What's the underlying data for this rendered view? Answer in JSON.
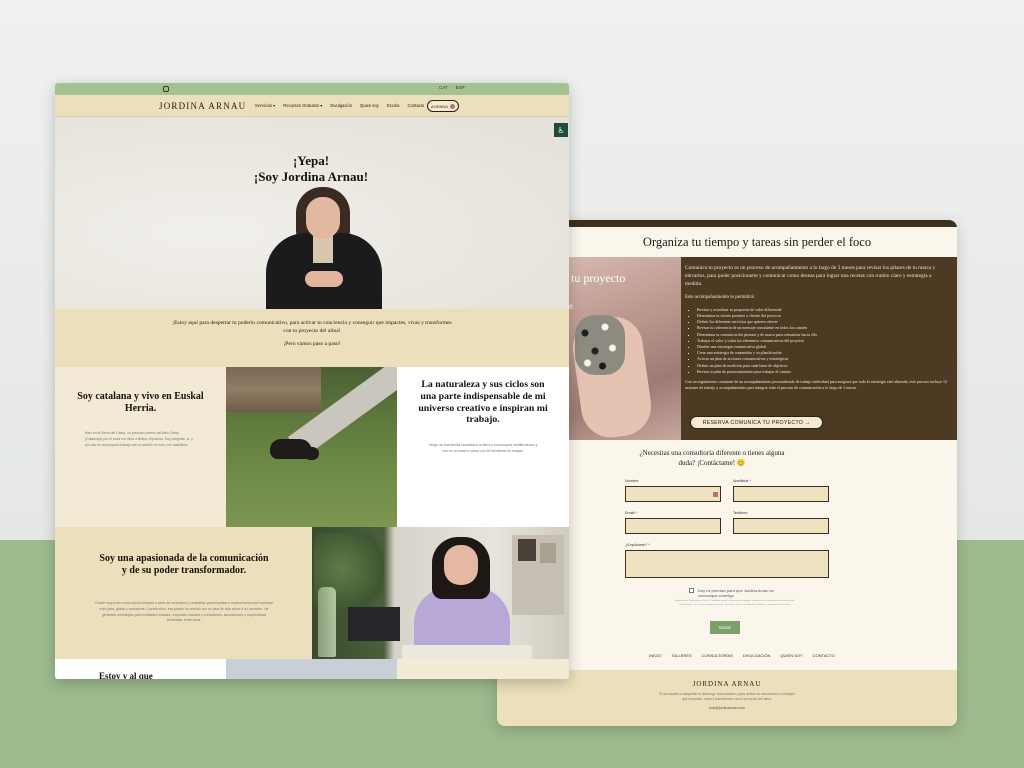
{
  "left_page": {
    "topbar": {
      "langs": [
        "CAT",
        "ESP"
      ]
    },
    "nav": {
      "logo": "JORDINA ARNAU",
      "menu": [
        "Servicios ▾",
        "Recursos Gratuitos ▾",
        "Divulgación",
        "Quien soy",
        "Escola",
        "Contacto"
      ],
      "agenda": "AGENDA"
    },
    "accessibility_icon": "accessibility-icon",
    "hero": {
      "title_line1": "¡Yepa!",
      "title_line2": "¡Soy Jordina Arnau!"
    },
    "intro": {
      "text": "¡Estoy aquí para despertar tu poderío comunicativo, para activar tu conciencia y conseguir que impactes, vivas y transformes con tu proyecto del alma!",
      "closing": "¡Pero vamos paso a paso!"
    },
    "block1": {
      "title": "Soy catalana y vivo en Euskal Herria.",
      "body": "Nací en la Selva del Camp, un precioso pueblo del Baix Camp (Catalunya) por el amor me llevó a Bidea, Gipuzkoa. Soy polígrafa, sí, y por eso en mi proyecto trabajo con el cambio, el euro y el castellano."
    },
    "block2": {
      "title": "La naturaleza y sus ciclos son una parte indispensable de mi universo creativo e inspiran mi trabajo.",
      "body": "Vengo de una familia vinculada a la tierra y los bosques mediterráneos y vivo en un caserío vasco con 50 hectáreas de bosque."
    },
    "block3": {
      "title": "Soy una apasionada de la comunicación y de su poder transformador.",
      "body": "Desde muy joven como acción integrar a partir de conceptos y campañas para impulsar a mucha fuerza una sociedad más justa, global y consciente. Cuenta años, esa pasión ha crecido con un plus de vida sobre a mí vocación. He generado estrategias para entidades sociales, empresas sociales y conscientes, asociaciones y cooperativas feministas, entre otros."
    },
    "block4": {
      "title": "Estoy y al que"
    }
  },
  "right_page": {
    "heading": "Organiza tu tiempo y tareas sin perder el foco",
    "photo_title": "tu proyecto",
    "photo_sub": "e",
    "intro": "Comunica tu proyecto es un proceso de acompañamiento a lo largo de 3 meses para revisar los pilares de tu marca y elevarlos, para poder posicionarte y comunicar como deseas para lograr una recetas con rumbo claro y estrategia a medida.",
    "sub": "Este acompañamiento te permitirá:",
    "bullets": [
      "Revisar y actualizar tu propuesta de valor diferencial",
      "Determinar tu cliente presente o cliente del proyecto",
      "Definir los diferentes servicios que quieres ofrecer",
      "Revisar tu coherencia de un mensaje consistente en todos los canales",
      "Determinar tu comunicación persona y de marca para comunicar hacia ella",
      "Trabajar el valor y todos los elementos comunicativos del proyecto",
      "Diseñar una estrategia comunicativa global",
      "Crear una estrategia de contenidos y su planificación",
      "Activar un plan de acciones comunicativas y estratégicas",
      "Definir un plan de medición para cada línea de objetivos",
      "Revisar tu plan de posicionamiento para trabajar el camino"
    ],
    "outro": "Con un seguimiento constante de un acompañamiento personalizado de trabajo individual para asegurar que toda la estrategia esté alineada, este proceso incluye 12 sesiones de trabajo y acompañamiento para integrar todo el proceso de comunicación a lo largo de 3 meses.",
    "cta": "RESERVA COMUNICA TU PROYECTO →",
    "form": {
      "title": "¿Necesitas una consultoría diferente o tienes alguna duda? ¡Contáctame! 😊",
      "name_label": "Nombre",
      "surname_label": "Apellidos *",
      "email_label": "Email *",
      "phone_label": "Teléfono",
      "message_label": "¿Explícame? *",
      "consent": "Doy mi permiso para que Jordina Arnau se comunique conmigo",
      "legal": "Responsable: Jordina Arnau Cortés. Finalidad: enviar la información solicitada. Legitimación: consentimiento del interesado. Destinatarios: no se cederán datos a terceros. Derechos: acceso, rectificación, limitación y supresión de los datos.",
      "send": "Enviar"
    },
    "footer_nav": [
      "INICIO",
      "TALLERES",
      "CONSULTORÍAS",
      "DIVULGACIÓN",
      "QUIÉN SOY",
      "CONTACTO"
    ],
    "footer": {
      "logo": "JORDINA ARNAU",
      "text": "Te acompaño a despertar tu liderazgo comunicativo, para activar tu conciencia y conseguir que impactes, vivas y transformes con tu proyecto del alma.",
      "email": "hola@jordinaarnau.com"
    }
  },
  "colors": {
    "green_band": "#a3c28f",
    "beige": "#ebdfbc",
    "dark_brown": "#4c3a22",
    "send_green": "#7da06a",
    "background_green": "#9dba8e"
  }
}
